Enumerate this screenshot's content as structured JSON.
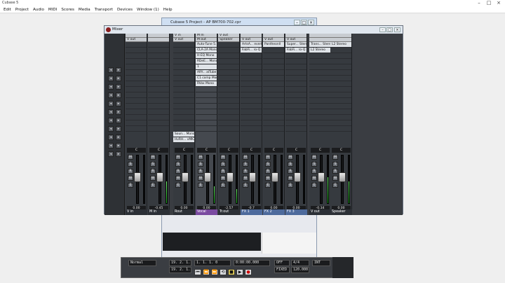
{
  "app": {
    "title": "Cubase 5",
    "menu": [
      "Edit",
      "Project",
      "Audio",
      "MIDI",
      "Scores",
      "Media",
      "Transport",
      "Devices",
      "Window (1)",
      "Help"
    ]
  },
  "project_window": {
    "title": "Cubase 5 Project - AP BM700-702.cpr"
  },
  "mixer": {
    "title": "Mixer",
    "channels": [
      {
        "id": "v-in",
        "name": "V in",
        "type": "input",
        "route": "",
        "out": "V out",
        "fader": 0.55,
        "meter": 0.0,
        "value": "0.00",
        "pan": "C",
        "inserts": [
          "",
          "",
          "",
          "",
          "",
          "",
          "",
          "",
          ""
        ],
        "sends": []
      },
      {
        "id": "m-in",
        "name": "M in",
        "type": "input",
        "route": "",
        "out": "",
        "fader": 0.55,
        "meter": 0.45,
        "value": "-0.45",
        "pan": "C",
        "inserts": [],
        "sends": []
      },
      {
        "id": "rout",
        "name": "Rout",
        "type": "audio",
        "route": "V in",
        "out": "V out",
        "fader": 0.55,
        "meter": 0.0,
        "value": "0.00",
        "pan": "C",
        "inserts": [
          "",
          "",
          "",
          "",
          "",
          "",
          "",
          "",
          "",
          ""
        ],
        "sends": [
          "Soun... Mono",
          "HvRH... vMK2"
        ]
      },
      {
        "id": "vocal",
        "name": "Vocal",
        "type": "audio",
        "route": "M In",
        "out": "M out",
        "fader": 0.55,
        "meter": 0.35,
        "value": "0.00",
        "pan": "C",
        "inserts": [
          "Auto-Tune 5.1",
          "CLA-2A Mono",
          "H-EQ Mono",
          "RDeE... Mono",
          "1",
          "ARY... alTube",
          "C1 comp Mono",
          "RVox Mono"
        ],
        "sends": []
      },
      {
        "id": "trout",
        "name": "Tr.out",
        "type": "audio",
        "route": "V out",
        "out": "Speaker",
        "fader": 0.55,
        "meter": 0.3,
        "value": "-2.57",
        "pan": "C",
        "inserts": [],
        "sends": []
      },
      {
        "id": "fx1",
        "name": "FX 1",
        "type": "fx",
        "route": "",
        "out": "V out",
        "fader": 0.55,
        "meter": 0.0,
        "value": "-0.7",
        "pan": "C",
        "inserts": [
          "ArtsA... everb",
          "FabFi... ro-Q 2"
        ],
        "sends": []
      },
      {
        "id": "fx2",
        "name": "FX 2",
        "type": "fx",
        "route": "",
        "out": "V out",
        "fader": 0.55,
        "meter": 0.0,
        "value": "0.00",
        "pan": "C",
        "inserts": [
          "Pantheonll"
        ],
        "sends": []
      },
      {
        "id": "fx3",
        "name": "FX 3",
        "type": "fx",
        "route": "",
        "out": "V out",
        "fader": 0.55,
        "meter": 0.0,
        "value": "0.00",
        "pan": "C",
        "inserts": [
          "Super... Stereo",
          "FabFi... ro-Q 2"
        ],
        "sends": []
      },
      {
        "id": "v-out",
        "name": "V out",
        "type": "output",
        "route": "",
        "out": "",
        "fader": 0.55,
        "meter": 0.55,
        "value": "-0.34",
        "pan": "C",
        "inserts": [
          "Trans... Stereo",
          "L2 Stereo"
        ],
        "sends": []
      },
      {
        "id": "speaker",
        "name": "Speaker",
        "type": "output",
        "route": "",
        "out": "",
        "fader": 0.55,
        "meter": 0.45,
        "value": "0.00",
        "pan": "C",
        "inserts": [
          "L2 Stereo"
        ],
        "sends": []
      }
    ]
  },
  "transport": {
    "mode": "Normal",
    "position": "1. 1. 1. 0",
    "time": "0:00:00.000",
    "tempo": "120.000",
    "signature": "4/4",
    "left_locator": "19. 2. 1. 91",
    "right_locator": "19. 2. 1. 91",
    "click": "OFF",
    "sync": "INT",
    "rec_mode": "FIXED"
  }
}
